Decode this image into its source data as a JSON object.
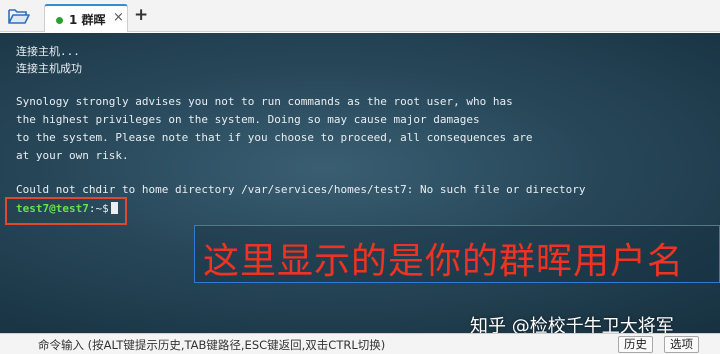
{
  "tabs": {
    "folder_icon": "folder-open-icon",
    "active_tab_label": "1 群晖",
    "close_glyph": "×",
    "add_glyph": "+"
  },
  "terminal": {
    "lines": [
      "连接主机...",
      "连接主机成功",
      "",
      "Synology strongly advises you not to run commands as the root user, who has",
      "the highest privileges on the system. Doing so may cause major damages",
      "to the system. Please note that if you choose to proceed, all consequences are",
      "at your own risk.",
      "",
      "Could not chdir to home directory /var/services/homes/test7: No such file or directory"
    ],
    "prompt_user": "test7@test7",
    "prompt_rest": ":~$",
    "colors": {
      "prompt_user": "#66e34a",
      "text": "#e8eef2",
      "highlight_border": "#e04a2a",
      "annotation_text": "#ee3322",
      "annotation_border": "#2a7fd4"
    }
  },
  "annotation": {
    "text": "这里显示的是你的群晖用户名"
  },
  "command_bar": {
    "hint": "命令输入 (按ALT键提示历史,TAB键路径,ESC键返回,双击CTRL切换)",
    "history_label": "历史",
    "options_label": "选项"
  },
  "watermark": {
    "text": "知乎 @检校千牛卫大将军"
  }
}
